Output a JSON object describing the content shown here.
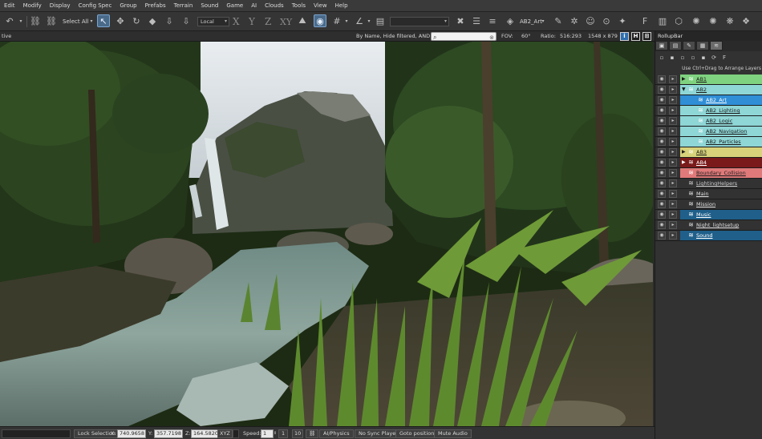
{
  "menu": [
    "Edit",
    "Modify",
    "Display",
    "Config Spec",
    "Group",
    "Prefabs",
    "Terrain",
    "Sound",
    "Game",
    "AI",
    "Clouds",
    "Tools",
    "View",
    "Help"
  ],
  "toolbar": {
    "select_all_label": "Select All",
    "coord_system": "Local",
    "axis_x": "X",
    "axis_y": "Y",
    "axis_z": "Z",
    "axis_xy": "XY",
    "layer_name": "AB2_Art"
  },
  "viewport_header": {
    "left_text": "tive",
    "filter_text": "By Name, Hide filtered, AND",
    "search_value": "",
    "fov_label": "FOV:",
    "fov_value": "60°",
    "ratio_label": "Ratio:",
    "ratio_value": "516:293",
    "resolution": "1548 x 879",
    "btn_info": "i",
    "btn_h": "H",
    "btn_grid": "⊞"
  },
  "rollup": {
    "title": "RollupBar",
    "hint": "Use Ctrl+Drag to Arrange Layers",
    "layers": [
      {
        "name": "AB1",
        "depth": 0,
        "expander": "▶",
        "bg": "#7fd27f",
        "fg": "#1a1a1a"
      },
      {
        "name": "AB2",
        "depth": 0,
        "expander": "▼",
        "bg": "#8fd6d6",
        "fg": "#1a1a1a"
      },
      {
        "name": "AB2_Art",
        "depth": 1,
        "expander": "",
        "bg": "#2f8ed6",
        "fg": "#ffffff"
      },
      {
        "name": "AB2_Lighting",
        "depth": 1,
        "expander": "",
        "bg": "#8fd6d6",
        "fg": "#1a1a1a"
      },
      {
        "name": "AB2_Logic",
        "depth": 1,
        "expander": "",
        "bg": "#8fd6d6",
        "fg": "#1a1a1a"
      },
      {
        "name": "AB2_Navigation",
        "depth": 1,
        "expander": "",
        "bg": "#8fd6d6",
        "fg": "#1a1a1a"
      },
      {
        "name": "AB2_Particles",
        "depth": 1,
        "expander": "",
        "bg": "#8fd6d6",
        "fg": "#1a1a1a"
      },
      {
        "name": "AB3",
        "depth": 0,
        "expander": "▶",
        "bg": "#d8d27a",
        "fg": "#1a1a1a"
      },
      {
        "name": "AB4",
        "depth": 0,
        "expander": "▶",
        "bg": "#7a1a1a",
        "fg": "#ffffff"
      },
      {
        "name": "Boundary_Collision",
        "depth": 0,
        "expander": "",
        "bg": "#e07a7a",
        "fg": "#1a1a1a"
      },
      {
        "name": "LightingHelpers",
        "depth": 0,
        "expander": "",
        "bg": "#323232",
        "fg": "#d0d0d0"
      },
      {
        "name": "Main",
        "depth": 0,
        "expander": "",
        "bg": "#323232",
        "fg": "#e0e0e0"
      },
      {
        "name": "Mission",
        "depth": 0,
        "expander": "",
        "bg": "#323232",
        "fg": "#e0e0e0"
      },
      {
        "name": "Music",
        "depth": 0,
        "expander": "",
        "bg": "#1f5f8a",
        "fg": "#ffffff"
      },
      {
        "name": "Night_lightsetup",
        "depth": 0,
        "expander": "",
        "bg": "#323232",
        "fg": "#e0e0e0"
      },
      {
        "name": "Sound",
        "depth": 0,
        "expander": "",
        "bg": "#1f5f8a",
        "fg": "#ffffff"
      }
    ]
  },
  "statusbar": {
    "lock_selection": "Lock Selection",
    "x_label": "X:",
    "x_value": "740.9658",
    "y_label": "Y:",
    "y_value": "357.7198",
    "z_label": "Z:",
    "z_value": "164.5820",
    "xyz": "XYZ",
    "speed_label": "Speed:",
    "speed_value": "1",
    "speed_1": "1",
    "speed_10": "10",
    "ai_physics": "AI/Physics",
    "no_sync_player": "No Sync Player",
    "goto_position": "Goto position",
    "mute_audio": "Mute Audio"
  },
  "colors": {
    "accent": "#2f8ed6",
    "panel": "#323232",
    "toolbar": "#353535"
  }
}
